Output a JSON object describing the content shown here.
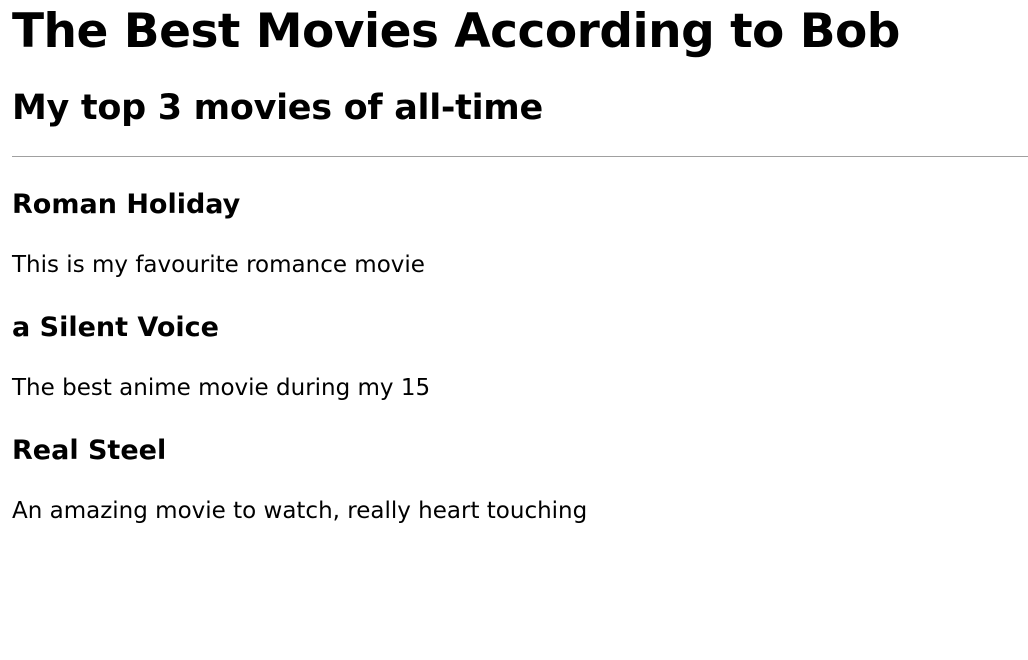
{
  "header": {
    "title": "The Best Movies According to Bob",
    "subtitle": "My top 3 movies of all-time"
  },
  "movies": [
    {
      "title": "Roman Holiday",
      "description": "This is my favourite romance movie"
    },
    {
      "title": "a Silent Voice",
      "description": "The best anime movie during my 15"
    },
    {
      "title": "Real Steel",
      "description": "An amazing movie to watch, really heart touching"
    }
  ]
}
